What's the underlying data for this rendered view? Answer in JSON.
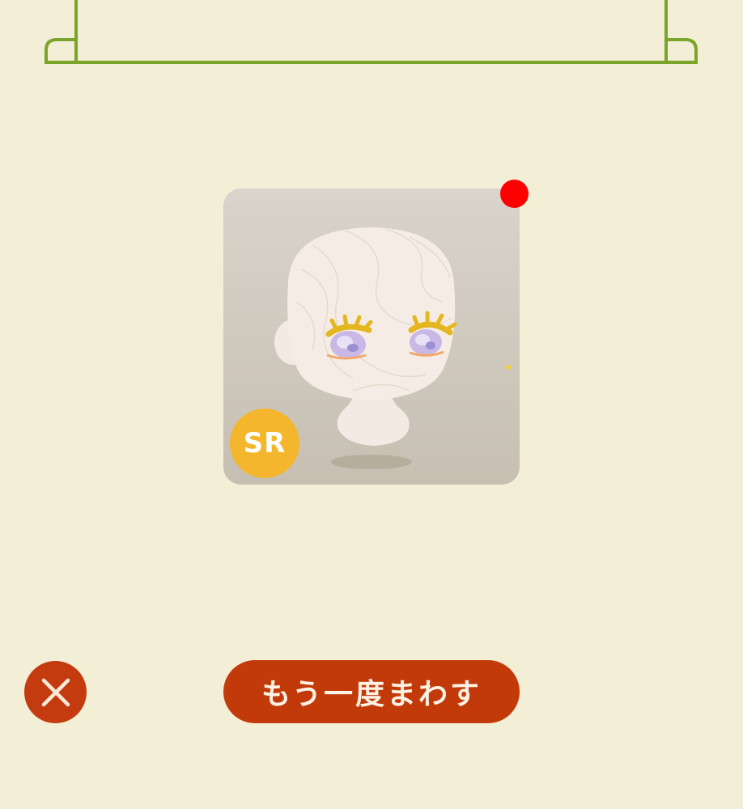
{
  "result": {
    "rarity": "SR",
    "item_icon": "doll-head-with-gold-eyelashes",
    "new_indicator_color": "#ff0000",
    "rarity_color": "#f4b62c"
  },
  "actions": {
    "close_icon": "close-icon",
    "spin_again_label": "もう一度まわす"
  },
  "colors": {
    "background": "#f3eed6",
    "frame": "#7aa52a",
    "button": "#c23a09"
  }
}
